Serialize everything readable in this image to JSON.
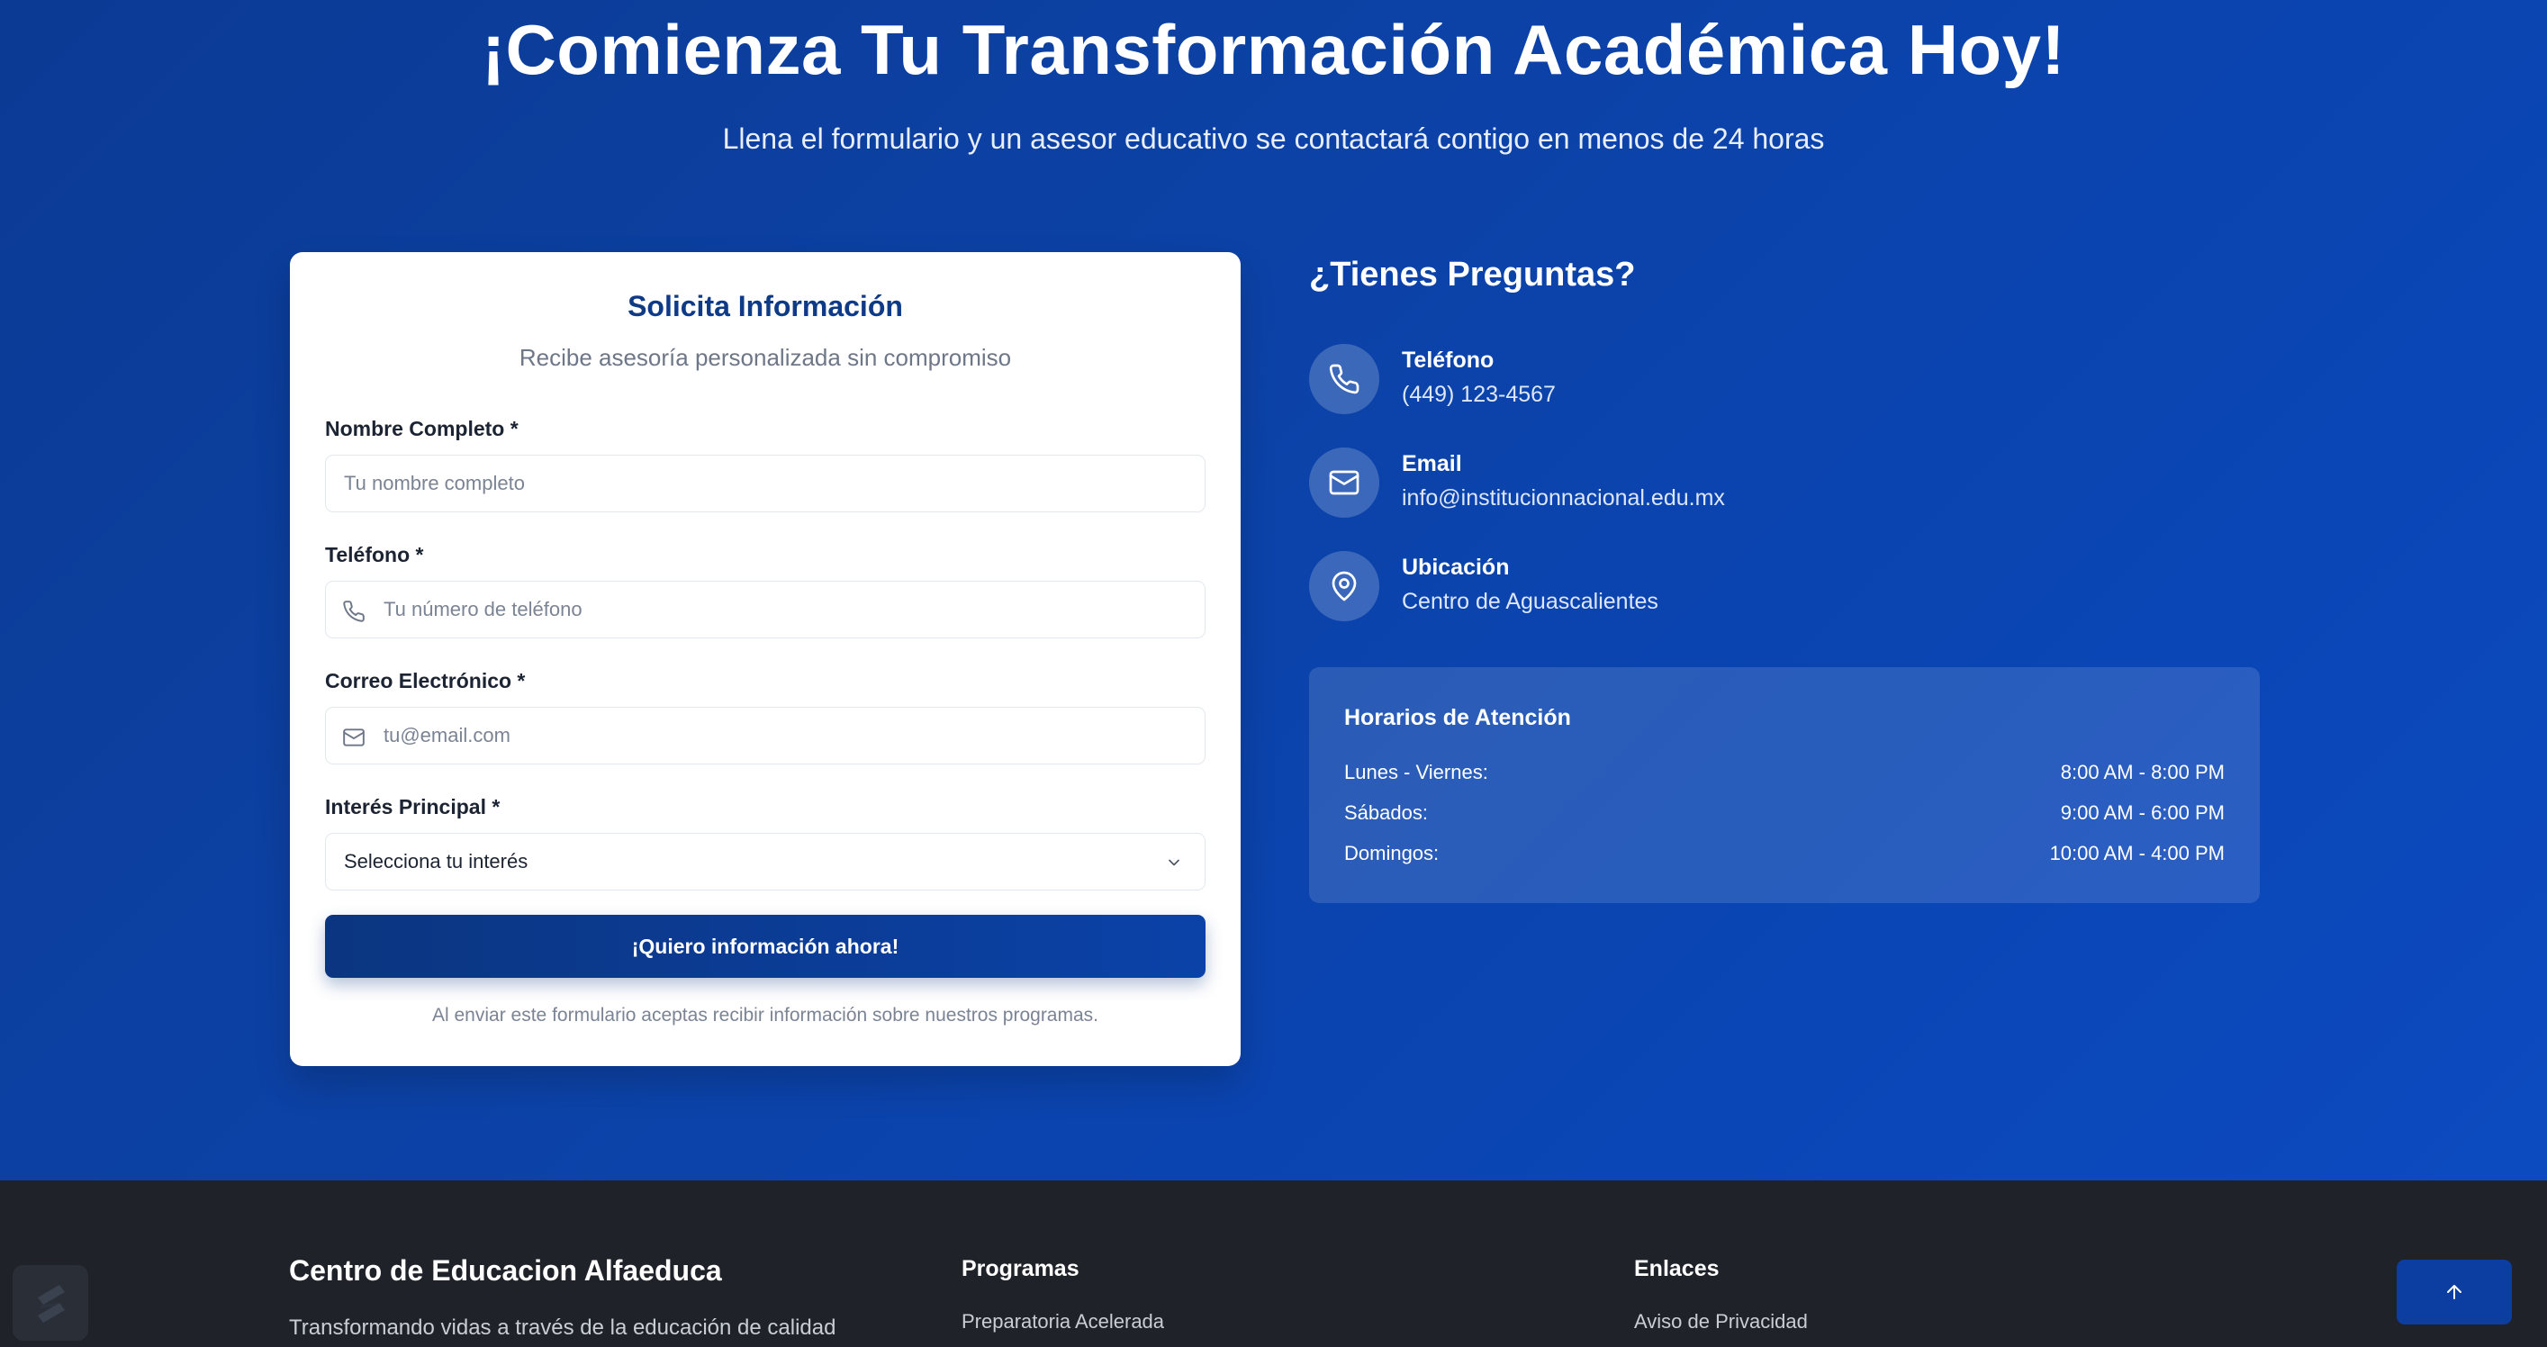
{
  "hero": {
    "title": "¡Comienza Tu Transformación Académica Hoy!",
    "subtitle": "Llena el formulario y un asesor educativo se contactará contigo en menos de 24 horas"
  },
  "form": {
    "title": "Solicita Información",
    "subtitle": "Recibe asesoría personalizada sin compromiso",
    "name_label": "Nombre Completo *",
    "name_placeholder": "Tu nombre completo",
    "phone_label": "Teléfono *",
    "phone_placeholder": "Tu número de teléfono",
    "email_label": "Correo Electrónico *",
    "email_placeholder": "tu@email.com",
    "interest_label": "Interés Principal *",
    "interest_selected": "Selecciona tu interés",
    "submit_label": "¡Quiero información ahora!",
    "disclaimer": "Al enviar este formulario aceptas recibir información sobre nuestros programas."
  },
  "info": {
    "title": "¿Tienes Preguntas?",
    "contacts": [
      {
        "label": "Teléfono",
        "value": "(449) 123-4567",
        "icon": "phone-icon"
      },
      {
        "label": "Email",
        "value": "info@institucionnacional.edu.mx",
        "icon": "mail-icon"
      },
      {
        "label": "Ubicación",
        "value": "Centro de Aguascalientes",
        "icon": "map-pin-icon"
      }
    ],
    "hours": {
      "title": "Horarios de Atención",
      "rows": [
        {
          "day": "Lunes - Viernes:",
          "time": "8:00 AM - 8:00 PM"
        },
        {
          "day": "Sábados:",
          "time": "9:00 AM - 6:00 PM"
        },
        {
          "day": "Domingos:",
          "time": "10:00 AM - 4:00 PM"
        }
      ]
    }
  },
  "footer": {
    "brand": "Centro de Educacion Alfaeduca",
    "description": "Transformando vidas a través de la educación de calidad",
    "programs_heading": "Programas",
    "programs_first": "Preparatoria Acelerada",
    "links_heading": "Enlaces",
    "links_first": "Aviso de Privacidad"
  },
  "colors": {
    "hero_bg": "#0c42a6",
    "card_title": "#0e3a86",
    "footer_bg": "#1f2329",
    "button_bg": "#0b3580"
  }
}
